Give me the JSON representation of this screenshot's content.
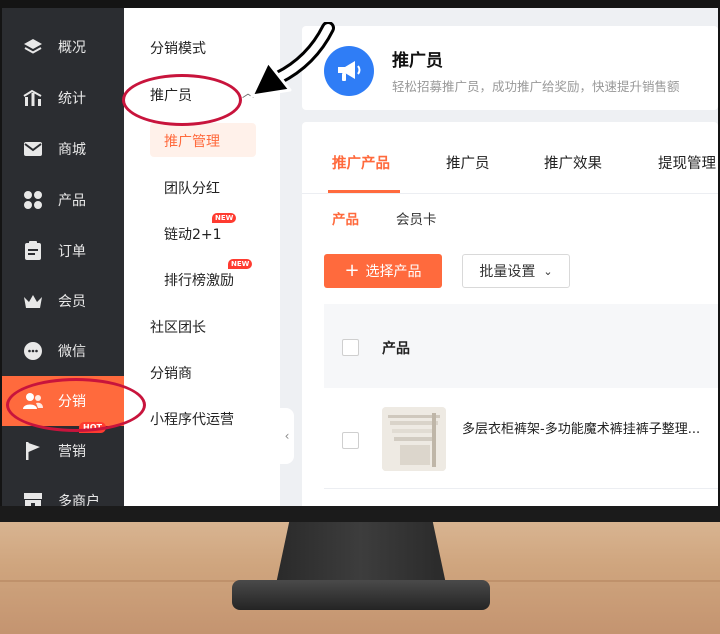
{
  "sidebar": {
    "items": [
      {
        "label": "概况",
        "icon": "layers-icon"
      },
      {
        "label": "统计",
        "icon": "chart-icon"
      },
      {
        "label": "商城",
        "icon": "mail-icon"
      },
      {
        "label": "产品",
        "icon": "grid-icon"
      },
      {
        "label": "订单",
        "icon": "clipboard-icon"
      },
      {
        "label": "会员",
        "icon": "crown-icon"
      },
      {
        "label": "微信",
        "icon": "chat-icon"
      },
      {
        "label": "分销",
        "icon": "users-icon"
      },
      {
        "label": "营销",
        "icon": "flag-icon",
        "badge": "HOT"
      },
      {
        "label": "多商户",
        "icon": "store-icon"
      }
    ],
    "active_index": 7
  },
  "submenu": {
    "mode": "分销模式",
    "group": "推广员",
    "children": [
      "推广管理",
      "团队分红",
      "链动2+1",
      "排行榜激励"
    ],
    "new_badge": "NEW",
    "others": [
      "社区团长",
      "分销商",
      "小程序代运营"
    ]
  },
  "header": {
    "title": "推广员",
    "description": "轻松招募推广员，成功推广给奖励，快速提升销售额"
  },
  "tabs": [
    "推广产品",
    "推广员",
    "推广效果",
    "提现管理"
  ],
  "subtabs": [
    "产品",
    "会员卡"
  ],
  "toolbar": {
    "select_label": "选择产品",
    "batch_label": "批量设置"
  },
  "table": {
    "header": "产品",
    "rows": [
      {
        "name": "多层衣柜裤架-多功能魔术裤挂裤子整理..."
      }
    ]
  },
  "colors": {
    "accent": "#ff6a3d",
    "sidebar_bg": "#2b2d31",
    "annotation": "#c8143c"
  }
}
